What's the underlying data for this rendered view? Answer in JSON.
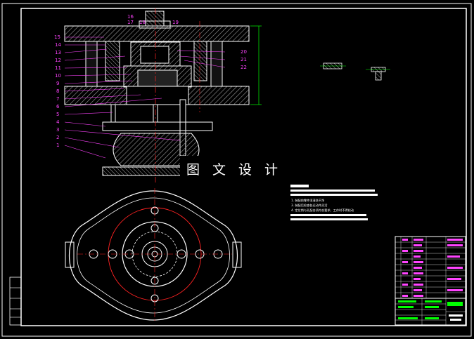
{
  "watermark": "图 文 设 计",
  "part_labels_left": [
    "15",
    "14",
    "13",
    "12",
    "11",
    "10",
    "9",
    "8",
    "7",
    "6",
    "5",
    "4",
    "3",
    "2",
    "1"
  ],
  "part_labels_top": [
    "16",
    "17",
    "18",
    "19"
  ],
  "part_labels_right": [
    "20",
    "21",
    "22"
  ],
  "tech_notes": [
    "1. 装配前零件须清洗干净",
    "3. 装配后检查各运动件灵活",
    "4. 定位销与孔配合须符合要求，工作时不得松动"
  ],
  "colors": {
    "frame": "#ffffff",
    "outline": "#ffffff",
    "callout": "#ff44ff",
    "hatch": "#888888",
    "centerline": "#ff2222",
    "dimension": "#00ff00",
    "watermark_bg": "#000000"
  }
}
